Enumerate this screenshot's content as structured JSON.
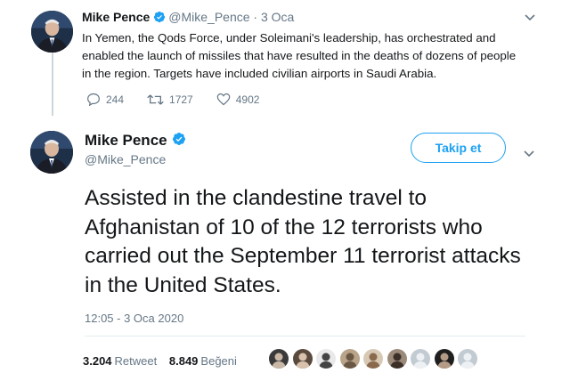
{
  "tweet1": {
    "author_name": "Mike Pence",
    "handle": "@Mike_Pence",
    "dot": "·",
    "date": "3 Oca",
    "text": "In Yemen, the Qods Force, under Soleimani's leadership, has orchestrated and enabled the launch of missiles that have resulted in the deaths of dozens of people in the region.  Targets have included civilian airports in Saudi Arabia.",
    "replies": "244",
    "retweets": "1727",
    "likes": "4902"
  },
  "tweet2": {
    "author_name": "Mike Pence",
    "handle": "@Mike_Pence",
    "follow_label": "Takip et",
    "text": "Assisted in the clandestine travel to Afghanistan of 10 of the 12 terrorists who carried out the September 11 terrorist attacks in the United States.",
    "timestamp": "12:05 - 3 Oca 2020",
    "retweet_count": "3.204",
    "retweet_label": "Retweet",
    "like_count": "8.849",
    "like_label": "Beğeni"
  },
  "icons": {
    "verified": "verified-badge-icon",
    "reply": "reply-icon",
    "retweet": "retweet-icon",
    "like": "heart-icon",
    "caret": "chevron-down-icon"
  },
  "colors": {
    "accent": "#1da1f2",
    "text": "#14171a",
    "muted": "#657786",
    "border": "#e6ecf0"
  },
  "liker_avatars": [
    {
      "bg": "#3a3a3a",
      "fg": "#c9b8a6"
    },
    {
      "bg": "#5a4a3e",
      "fg": "#d8c2ae"
    },
    {
      "bg": "#e9e9e9",
      "fg": "#444444"
    },
    {
      "bg": "#b9a48a",
      "fg": "#6b5844"
    },
    {
      "bg": "#d8c9b5",
      "fg": "#8a6a4c"
    },
    {
      "bg": "#9b8a7a",
      "fg": "#3b2f28"
    },
    {
      "bg": "#c2cad2",
      "fg": "#eef1f4"
    },
    {
      "bg": "#1f1f1f",
      "fg": "#b59b85"
    },
    {
      "bg": "#c2cad2",
      "fg": "#eef1f4"
    }
  ]
}
